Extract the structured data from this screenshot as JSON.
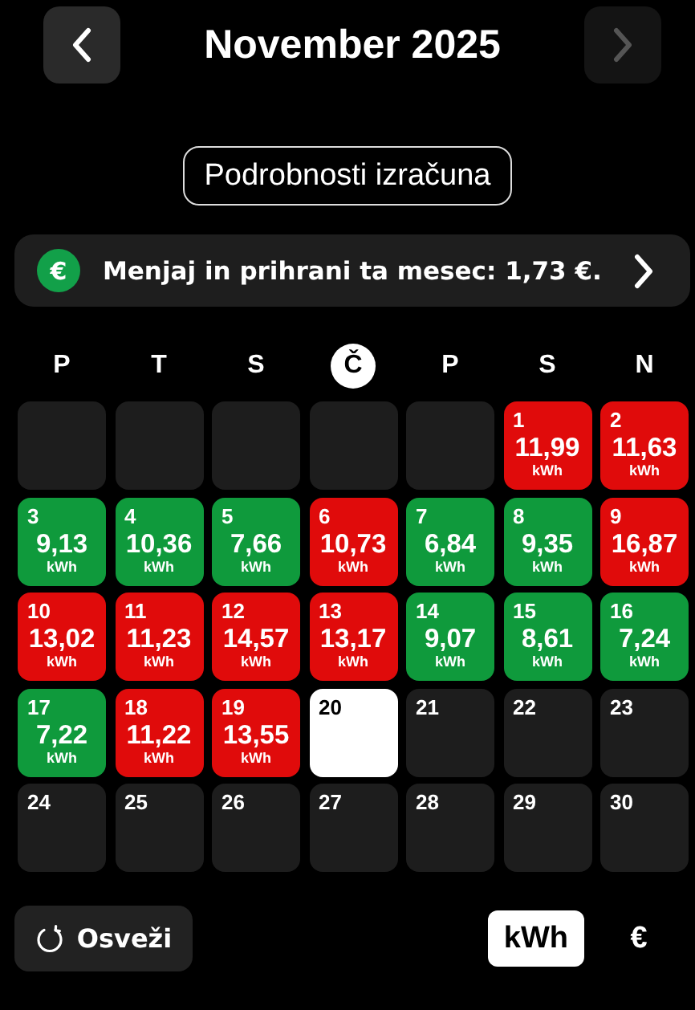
{
  "header": {
    "title": "November 2025",
    "prev_disabled": false,
    "next_disabled": true
  },
  "details_button": "Podrobnosti izračuna",
  "banner": {
    "icon": "€",
    "text": "Menjaj in prihrani ta mesec: 1,73 €."
  },
  "weekdays": [
    {
      "label": "P",
      "today": false
    },
    {
      "label": "T",
      "today": false
    },
    {
      "label": "S",
      "today": false
    },
    {
      "label": "Č",
      "today": true
    },
    {
      "label": "P",
      "today": false
    },
    {
      "label": "S",
      "today": false
    },
    {
      "label": "N",
      "today": false
    }
  ],
  "days": [
    {
      "kind": "blank"
    },
    {
      "kind": "blank"
    },
    {
      "kind": "blank"
    },
    {
      "kind": "blank"
    },
    {
      "kind": "blank"
    },
    {
      "kind": "high",
      "day": "1",
      "value": "11,99",
      "unit": "kWh"
    },
    {
      "kind": "high",
      "day": "2",
      "value": "11,63",
      "unit": "kWh"
    },
    {
      "kind": "low",
      "day": "3",
      "value": "9,13",
      "unit": "kWh"
    },
    {
      "kind": "low",
      "day": "4",
      "value": "10,36",
      "unit": "kWh"
    },
    {
      "kind": "low",
      "day": "5",
      "value": "7,66",
      "unit": "kWh"
    },
    {
      "kind": "high",
      "day": "6",
      "value": "10,73",
      "unit": "kWh"
    },
    {
      "kind": "low",
      "day": "7",
      "value": "6,84",
      "unit": "kWh"
    },
    {
      "kind": "low",
      "day": "8",
      "value": "9,35",
      "unit": "kWh"
    },
    {
      "kind": "high",
      "day": "9",
      "value": "16,87",
      "unit": "kWh"
    },
    {
      "kind": "high",
      "day": "10",
      "value": "13,02",
      "unit": "kWh"
    },
    {
      "kind": "high",
      "day": "11",
      "value": "11,23",
      "unit": "kWh"
    },
    {
      "kind": "high",
      "day": "12",
      "value": "14,57",
      "unit": "kWh"
    },
    {
      "kind": "high",
      "day": "13",
      "value": "13,17",
      "unit": "kWh"
    },
    {
      "kind": "low",
      "day": "14",
      "value": "9,07",
      "unit": "kWh"
    },
    {
      "kind": "low",
      "day": "15",
      "value": "8,61",
      "unit": "kWh"
    },
    {
      "kind": "low",
      "day": "16",
      "value": "7,24",
      "unit": "kWh"
    },
    {
      "kind": "low",
      "day": "17",
      "value": "7,22",
      "unit": "kWh"
    },
    {
      "kind": "high",
      "day": "18",
      "value": "11,22",
      "unit": "kWh"
    },
    {
      "kind": "high",
      "day": "19",
      "value": "13,55",
      "unit": "kWh"
    },
    {
      "kind": "today",
      "day": "20"
    },
    {
      "kind": "future",
      "day": "21"
    },
    {
      "kind": "future",
      "day": "22"
    },
    {
      "kind": "future",
      "day": "23"
    },
    {
      "kind": "future",
      "day": "24"
    },
    {
      "kind": "future",
      "day": "25"
    },
    {
      "kind": "future",
      "day": "26"
    },
    {
      "kind": "future",
      "day": "27"
    },
    {
      "kind": "future",
      "day": "28"
    },
    {
      "kind": "future",
      "day": "29"
    },
    {
      "kind": "future",
      "day": "30"
    }
  ],
  "refresh_button": "Osveži",
  "units": [
    {
      "label": "kWh",
      "selected": true
    },
    {
      "label": "€",
      "selected": false
    }
  ]
}
